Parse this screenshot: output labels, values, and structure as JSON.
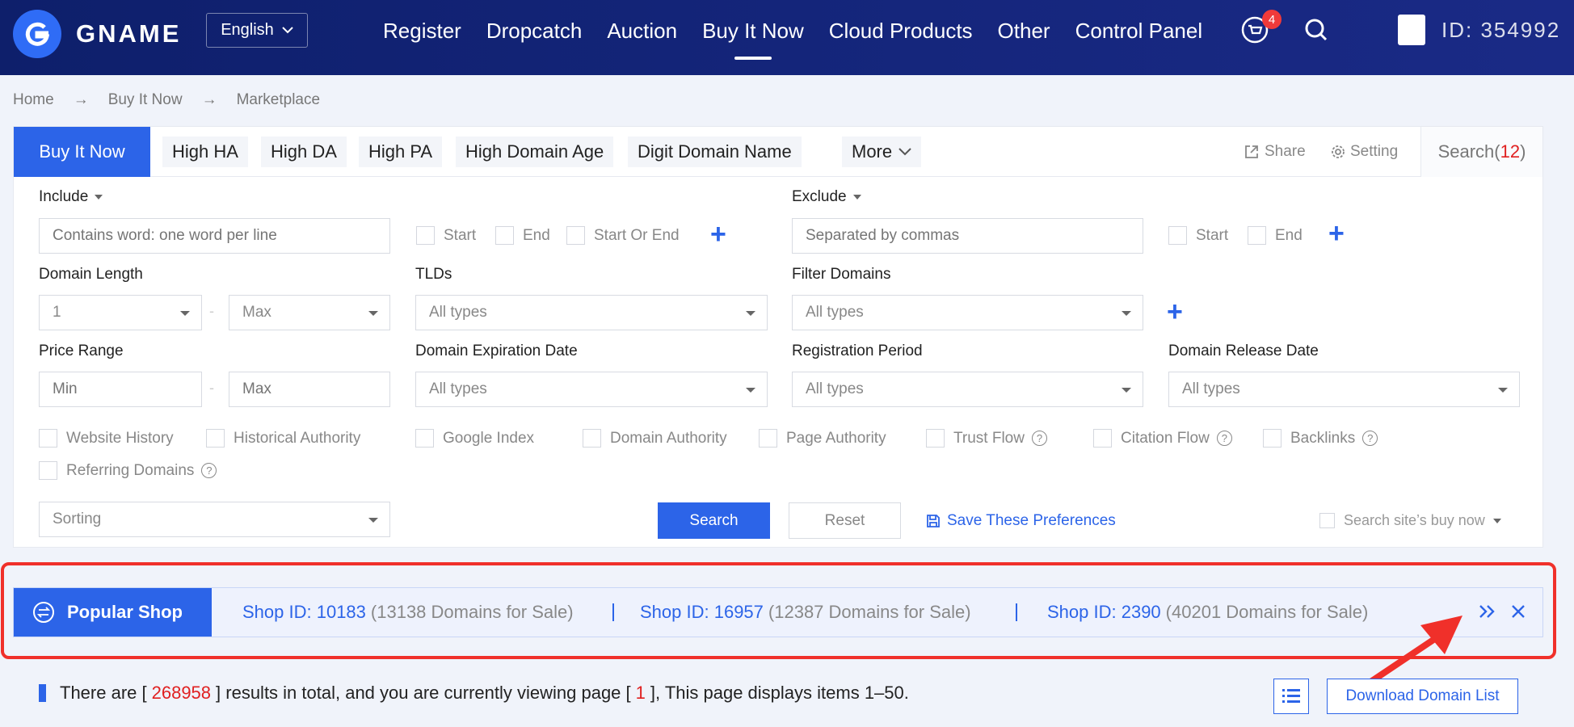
{
  "header": {
    "logo_text": "GNAME",
    "language": "English",
    "nav": [
      "Register",
      "Dropcatch",
      "Auction",
      "Buy It Now",
      "Cloud Products",
      "Other",
      "Control Panel"
    ],
    "cart_badge": "4",
    "user_id": "ID: 354992"
  },
  "breadcrumb": [
    "Home",
    "Buy It Now",
    "Marketplace"
  ],
  "tabs": {
    "active": "Buy It Now",
    "items": [
      "High HA",
      "High DA",
      "High PA",
      "High Domain Age",
      "Digit Domain Name"
    ],
    "more": "More",
    "share": "Share",
    "setting": "Setting",
    "search_label": "Search",
    "search_count": "12"
  },
  "filters": {
    "include_label": "Include",
    "include_placeholder": "Contains word: one word per line",
    "include_opts": [
      "Start",
      "End",
      "Start Or End"
    ],
    "exclude_label": "Exclude",
    "exclude_placeholder": "Separated by commas",
    "exclude_opts": [
      "Start",
      "End"
    ],
    "domain_length_label": "Domain Length",
    "length_min": "1",
    "length_max": "Max",
    "tlds_label": "TLDs",
    "all_types": "All types",
    "filter_domains_label": "Filter Domains",
    "price_range_label": "Price Range",
    "price_min": "Min",
    "price_max": "Max",
    "expiration_label": "Domain Expiration Date",
    "registration_label": "Registration Period",
    "release_label": "Domain Release Date",
    "checks": [
      "Website History",
      "Historical Authority",
      "Google Index",
      "Domain Authority",
      "Page Authority",
      "Trust Flow",
      "Citation Flow",
      "Backlinks",
      "Referring Domains"
    ],
    "sorting": "Sorting",
    "search_btn": "Search",
    "reset_btn": "Reset",
    "save_pref": "Save These Preferences",
    "site_buy": "Search site’s buy now"
  },
  "popular_shop": {
    "label": "Popular Shop",
    "shops": [
      {
        "id": "Shop ID: 10183",
        "count": "(13138 Domains for Sale)"
      },
      {
        "id": "Shop ID: 16957",
        "count": "(12387 Domains for Sale)"
      },
      {
        "id": "Shop ID: 2390",
        "count": "(40201 Domains for Sale)"
      }
    ]
  },
  "results": {
    "prefix": "There are [",
    "total": "268958",
    "middle": "] results in total, and you are currently viewing page [",
    "page": "1",
    "suffix": "], This page displays items 1–50.",
    "download": "Download Domain List"
  },
  "colors": {
    "accent": "#2c64e8",
    "header": "#14257a",
    "highlight": "#f0302a"
  }
}
